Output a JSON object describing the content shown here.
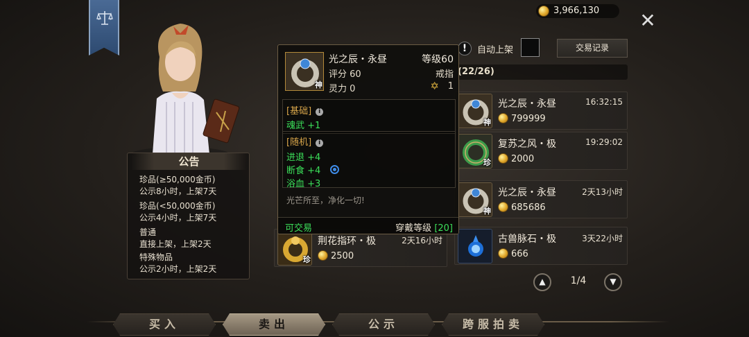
{
  "banner": {
    "icon": "scales-icon"
  },
  "notice": {
    "title": "公告",
    "groups": [
      {
        "line1": "珍品(≥50,000金币)",
        "line2": "公示8小时，上架7天"
      },
      {
        "line1": "珍品(<50,000金币)",
        "line2": "公示4小时，上架7天"
      },
      {
        "line1": "普通",
        "line2": "直接上架，上架2天"
      },
      {
        "line1": "特殊物品",
        "line2": "公示2小时，上架2天"
      }
    ]
  },
  "header": {
    "gold": "3,966,130",
    "close_icon": "close-icon",
    "auto_list_label": "自动上架",
    "records_label": "交易记录",
    "slot_count": "(22/26)"
  },
  "listings": [
    {
      "name": "光之辰・永昼",
      "time": "16:32:15",
      "price": "799999",
      "rarity": "神"
    },
    {
      "name": "复苏之风・极",
      "time": "19:29:02",
      "price": "2000",
      "rarity": "珍"
    },
    {
      "name": "光之辰・永昼",
      "time": "2天13小时",
      "price": "685686",
      "rarity": "神"
    },
    {
      "name": "古兽脉石・极",
      "time": "3天22小时",
      "price": "666",
      "rarity": ""
    }
  ],
  "left_card": {
    "name": "荆花指环・极",
    "time": "2天16小时",
    "price": "2500",
    "rarity": "珍"
  },
  "tooltip": {
    "name": "光之辰・永昼",
    "level": "等级60",
    "score": "评分 60",
    "slot": "戒指",
    "spirit": "灵力 0",
    "star_count": "1",
    "rarity": "神",
    "basic_header": "[基础]",
    "basic_stats": [
      "魂武 +1"
    ],
    "random_header": "[随机]",
    "random_stats": [
      "进退 +4",
      "断食 +4",
      "浴血 +3"
    ],
    "flavor": "光芒所至，净化一切!",
    "tradable": "可交易",
    "wear_level_label": "穿戴等级",
    "wear_level_value": "[20]"
  },
  "pagination": {
    "current": "1/4"
  },
  "tabs": [
    {
      "label": "买入",
      "active": false
    },
    {
      "label": "卖出",
      "active": true
    },
    {
      "label": "公示",
      "active": false
    },
    {
      "label": "跨服拍卖",
      "active": false
    }
  ],
  "colors": {
    "stat_green": "#3ce05a",
    "gold": "#e0a72a",
    "header_orange": "#d8a54a"
  }
}
